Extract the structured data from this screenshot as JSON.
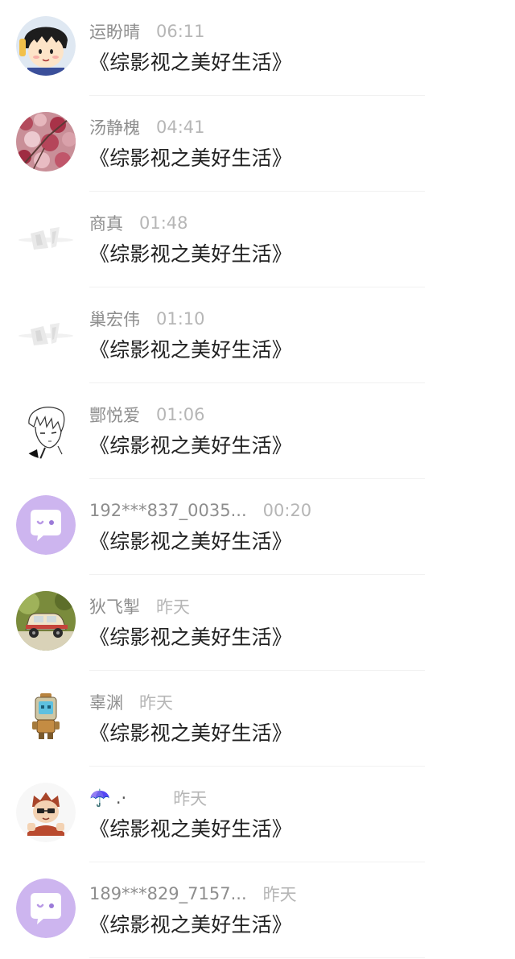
{
  "items": [
    {
      "name": "运盼晴",
      "time": "06:11",
      "title": "《综影视之美好生活》",
      "avatar": "cartoon-girl-avatar"
    },
    {
      "name": "汤静槐",
      "time": "04:41",
      "title": "《综影视之美好生活》",
      "avatar": "blossom-photo-avatar"
    },
    {
      "name": "商真",
      "time": "01:48",
      "title": "《综影视之美好生活》",
      "avatar": "default-placeholder-avatar"
    },
    {
      "name": "巢宏伟",
      "time": "01:10",
      "title": "《综影视之美好生活》",
      "avatar": "default-placeholder-avatar"
    },
    {
      "name": "酆悦爱",
      "time": "01:06",
      "title": "《综影视之美好生活》",
      "avatar": "sketch-portrait-avatar"
    },
    {
      "name": "192***837_0035...",
      "time": "00:20",
      "title": "《综影视之美好生活》",
      "avatar": "purple-chat-default-avatar"
    },
    {
      "name": "狄飞掣",
      "time": "昨天",
      "title": "《综影视之美好生活》",
      "avatar": "toy-car-avatar"
    },
    {
      "name": "辜渊",
      "time": "昨天",
      "title": "《综影视之美好生活》",
      "avatar": "robot-character-avatar"
    },
    {
      "name": "☂️ .·",
      "time": "昨天",
      "title": "《综影视之美好生活》",
      "avatar": "cartoon-kid-avatar"
    },
    {
      "name": "189***829_7157...",
      "time": "昨天",
      "title": "《综影视之美好生活》",
      "avatar": "purple-chat-default-avatar"
    }
  ]
}
